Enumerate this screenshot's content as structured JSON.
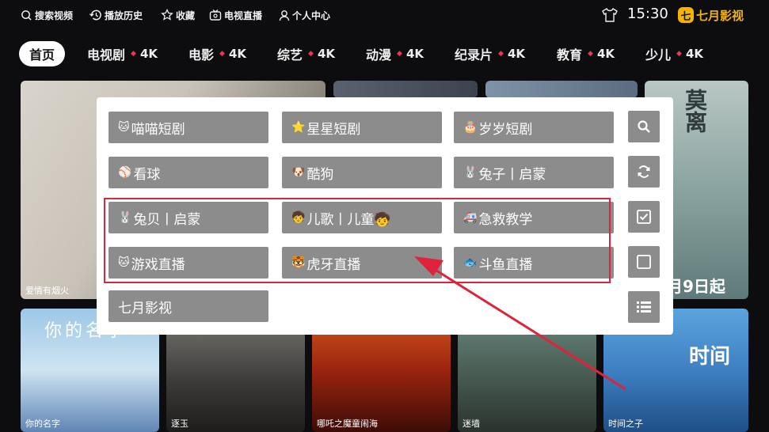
{
  "topbar": {
    "search": "搜索视频",
    "history": "播放历史",
    "favorites": "收藏",
    "live_tv": "电视直播",
    "profile": "个人中心",
    "time": "15:30",
    "brand": "七月影视",
    "brand_logo": "七"
  },
  "nav": {
    "home": "首页",
    "badge": "4K",
    "items": [
      "电视剧",
      "电影",
      "综艺",
      "动漫",
      "纪录片",
      "教育",
      "少儿"
    ]
  },
  "posters": {
    "p1": "爱情有烟火",
    "p5_title": "莫离",
    "p5_date": "月9日起",
    "p6_title": "你的名字",
    "p6_caption": "你的名字",
    "p7": "逐玉",
    "p8": "哪吒之魔童闹海",
    "p9": "迷墙",
    "p10_caption": "时间之子",
    "p10_logo": "时间"
  },
  "panel": {
    "tiles": [
      {
        "emoji": "🐱",
        "label": "喵喵短剧"
      },
      {
        "emoji": "⭐",
        "label": "星星短剧"
      },
      {
        "emoji": "🎂",
        "label": "岁岁短剧"
      },
      {
        "emoji": "⚾",
        "label": "看球"
      },
      {
        "emoji": "🐶",
        "label": "酷狗"
      },
      {
        "emoji": "🐰",
        "label": "兔子丨启蒙"
      },
      {
        "emoji": "🐰",
        "label": "兔贝丨启蒙"
      },
      {
        "emoji": "🧒",
        "label": "儿歌丨儿童🧒"
      },
      {
        "emoji": "🚑",
        "label": "急救教学"
      },
      {
        "emoji": "🐱",
        "label": "游戏直播"
      },
      {
        "emoji": "🐯",
        "label": "虎牙直播"
      },
      {
        "emoji": "🐟",
        "label": "斗鱼直播"
      },
      {
        "emoji": "",
        "label": "七月影视"
      }
    ],
    "side_buttons": [
      "search-icon",
      "refresh-icon",
      "checkbox-checked-icon",
      "checkbox-empty-icon",
      "list-icon"
    ]
  },
  "colors": {
    "accent_brand": "#f4b400",
    "highlight": "#e0223a",
    "tile_bg": "#8c8c8c",
    "nav_dot": "#e83a52"
  }
}
